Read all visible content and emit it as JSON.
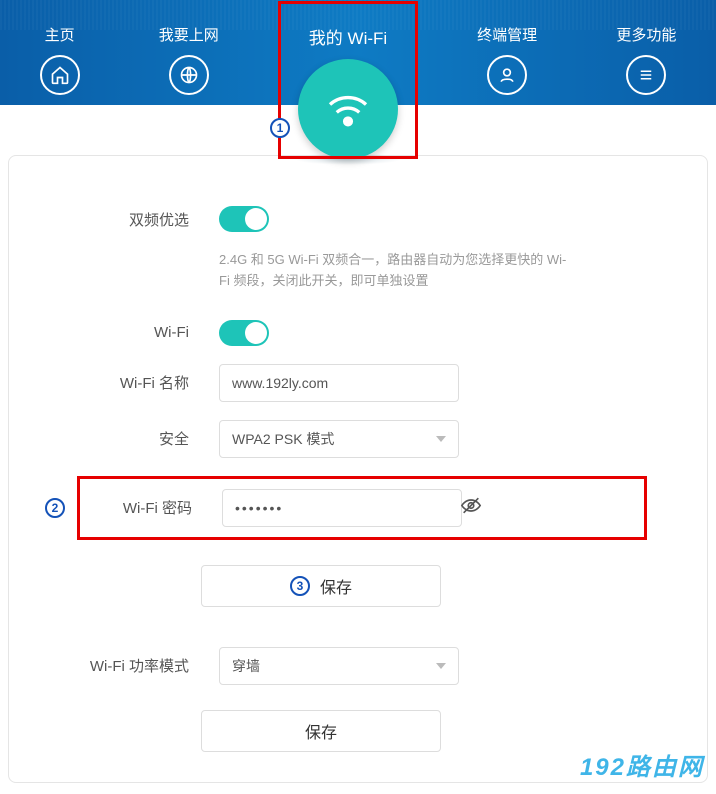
{
  "nav": {
    "home": "主页",
    "internet": "我要上网",
    "wifi": "我的 Wi-Fi",
    "devices": "终端管理",
    "more": "更多功能"
  },
  "form": {
    "dual_band_label": "双频优选",
    "dual_band_help": "2.4G 和 5G Wi-Fi 双频合一，路由器自动为您选择更快的 Wi-Fi 频段，关闭此开关，即可单独设置",
    "wifi_label": "Wi-Fi",
    "wifi_name_label": "Wi-Fi 名称",
    "wifi_name_value": "www.192ly.com",
    "security_label": "安全",
    "security_value": "WPA2 PSK 模式",
    "password_label": "Wi-Fi 密码",
    "password_value": "•••••••",
    "save_button": "保存",
    "power_mode_label": "Wi-Fi 功率模式",
    "power_mode_value": "穿墙",
    "save_button2": "保存"
  },
  "badges": {
    "b1": "1",
    "b2": "2",
    "b3": "3"
  },
  "watermark": "192路由网"
}
